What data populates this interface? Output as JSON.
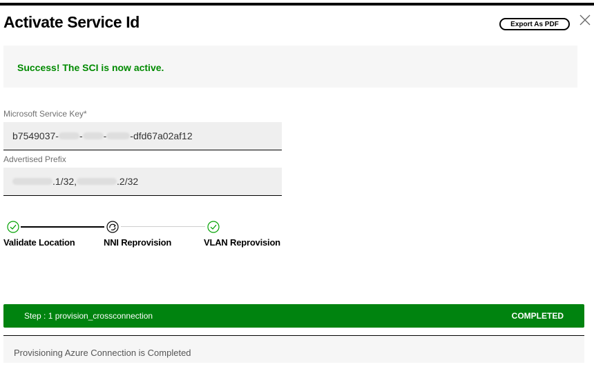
{
  "dialog": {
    "title": "Activate Service Id",
    "export_label": "Export As PDF"
  },
  "alert": {
    "message": "Success! The SCI is now active.",
    "color": "#008a00"
  },
  "fields": {
    "service_key": {
      "label": "Microsoft Service Key*",
      "value_prefix": "b7549037-",
      "value_sep1": "-",
      "value_sep2": "-",
      "value_suffix": "-dfd67a02af12"
    },
    "advertised_prefix": {
      "label": "Advertised Prefix",
      "value_part1": ".1/32,",
      "value_part2": ".2/32"
    }
  },
  "stepper": {
    "steps": [
      {
        "label": "Validate Location",
        "state": "done",
        "icon": "check-circle-icon"
      },
      {
        "label": "NNI Reprovision",
        "state": "in-progress",
        "icon": "refresh-circle-icon"
      },
      {
        "label": "VLAN Reprovision",
        "state": "done",
        "icon": "check-circle-icon"
      }
    ]
  },
  "status": {
    "step_text": "Step : 1 provision_crossconnection",
    "state_text": "COMPLETED",
    "color": "#00830f"
  },
  "result": {
    "message": "Provisioning Azure Connection is Completed"
  }
}
